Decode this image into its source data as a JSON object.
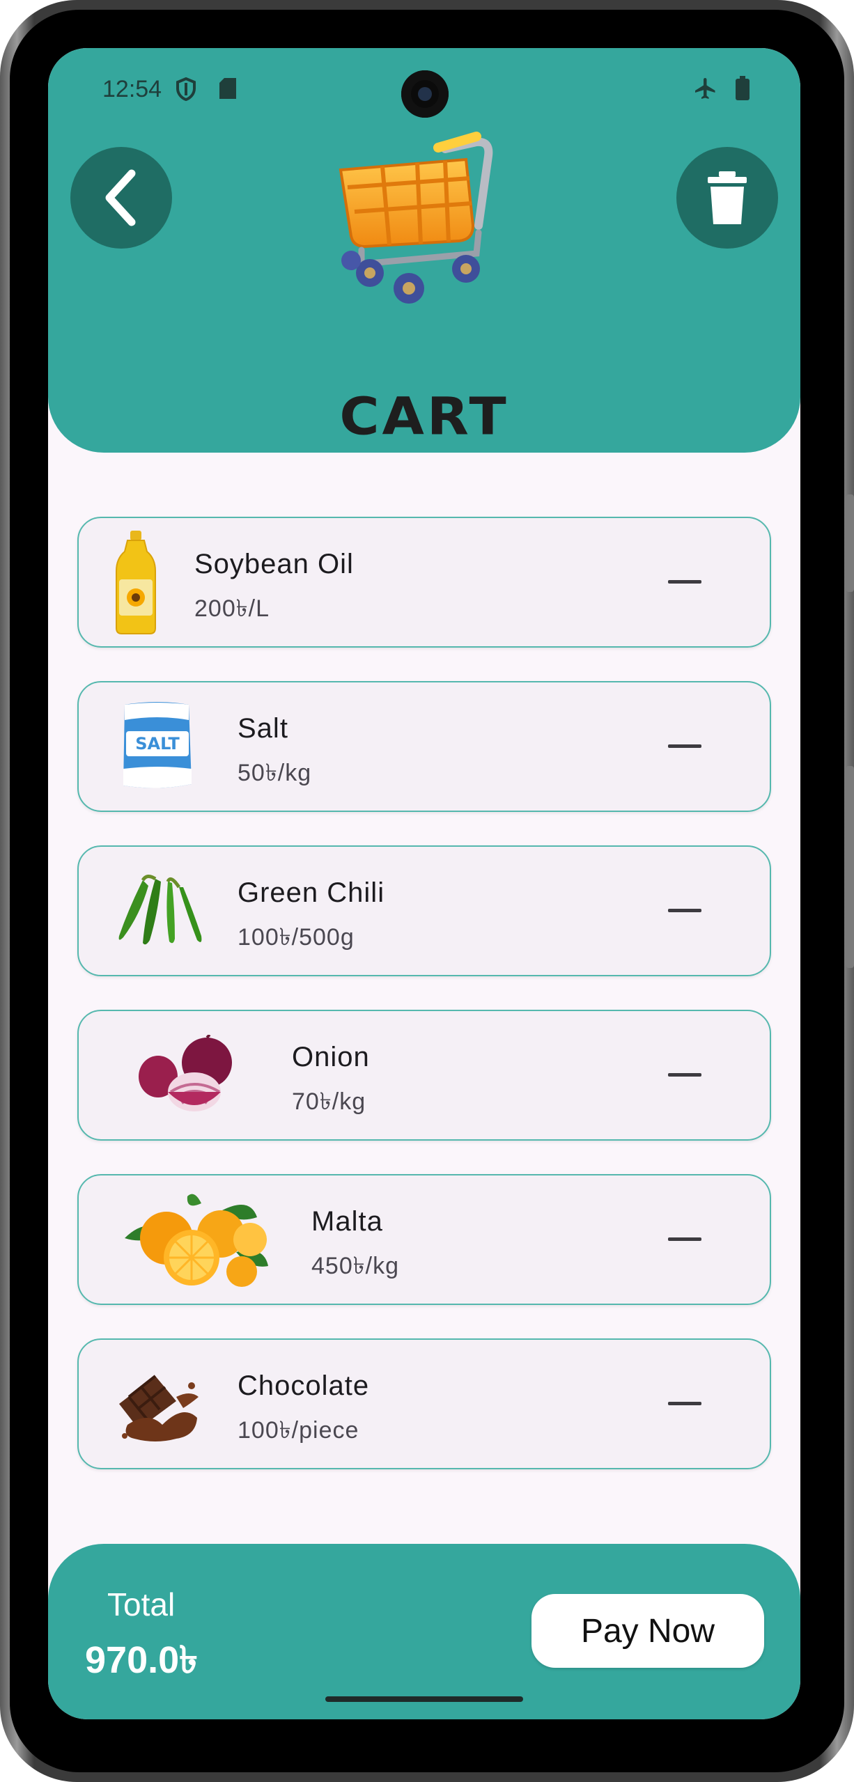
{
  "status_bar": {
    "time": "12:54",
    "icons": [
      "shield-icon",
      "sd-card-icon",
      "camera-cutout",
      "airplane-mode-icon",
      "battery-icon"
    ]
  },
  "header": {
    "title": "CART",
    "back_icon": "chevron-left-icon",
    "delete_icon": "trash-icon",
    "illustration": "shopping-cart-image"
  },
  "items": [
    {
      "name": "Soybean Oil",
      "price": "200৳/L",
      "image": "oil-bottle-image"
    },
    {
      "name": "Salt",
      "price": "50৳/kg",
      "image": "salt-bag-image",
      "image_text": "SALT"
    },
    {
      "name": "Green Chili",
      "price": "100৳/500g",
      "image": "green-chili-image"
    },
    {
      "name": "Onion",
      "price": "70৳/kg",
      "image": "onion-image"
    },
    {
      "name": "Malta",
      "price": "450৳/kg",
      "image": "orange-image"
    },
    {
      "name": "Chocolate",
      "price": "100৳/piece",
      "image": "chocolate-image"
    }
  ],
  "footer": {
    "total_label": "Total",
    "total_value": "970.0৳",
    "pay_button": "Pay Now"
  },
  "colors": {
    "primary": "#35a79d",
    "button_dark": "#1f6d64",
    "card_border": "#55b8ae",
    "card_bg": "#f5f0f6",
    "screen_bg": "#fbf6fb"
  }
}
